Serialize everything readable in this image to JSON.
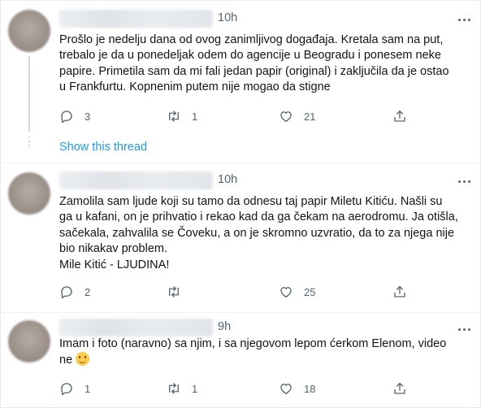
{
  "tweets": [
    {
      "time": "10h",
      "text": "Prošlo je nedelju dana od ovog zanimljivog događaja. Kretala sam na put,\ntrebalo je da u ponedeljak odem do agencije u Beogradu i ponesem neke\npapire. Primetila sam da mi fali jedan papir (original) i zaključila da je ostao\nu Frankfurtu. Kopnenim putem nije mogao da stigne",
      "replies": "3",
      "retweets": "1",
      "likes": "21"
    },
    {
      "time": "10h",
      "text": "Zamolila sam ljude koji su tamo da odnesu taj papir Miletu Kitiću. Našli su\nga u kafani, on je prihvatio i rekao kad da ga čekam na aerodromu. Ja otišla,\nsačekala, zahvalila se Čoveku, a on je skromno uzvratio, da to za njega nije\nbio nikakav problem.\nMile Kitić - LJUDINA!",
      "replies": "2",
      "retweets": "",
      "likes": "25"
    },
    {
      "time": "9h",
      "text": "Imam i foto (naravno) sa njim, i sa njegovom lepom ćerkom Elenom, video\nne",
      "emoji": "slightly-smiling-face",
      "replies": "1",
      "retweets": "1",
      "likes": "18"
    }
  ],
  "show_thread": "Show this thread",
  "icons": {
    "reply": "reply-icon",
    "retweet": "retweet-icon",
    "like": "heart-icon",
    "share": "share-icon",
    "more": "more-options-icon"
  },
  "colors": {
    "link": "#1d9bf0",
    "muted": "#536471",
    "text": "#0f1419"
  }
}
